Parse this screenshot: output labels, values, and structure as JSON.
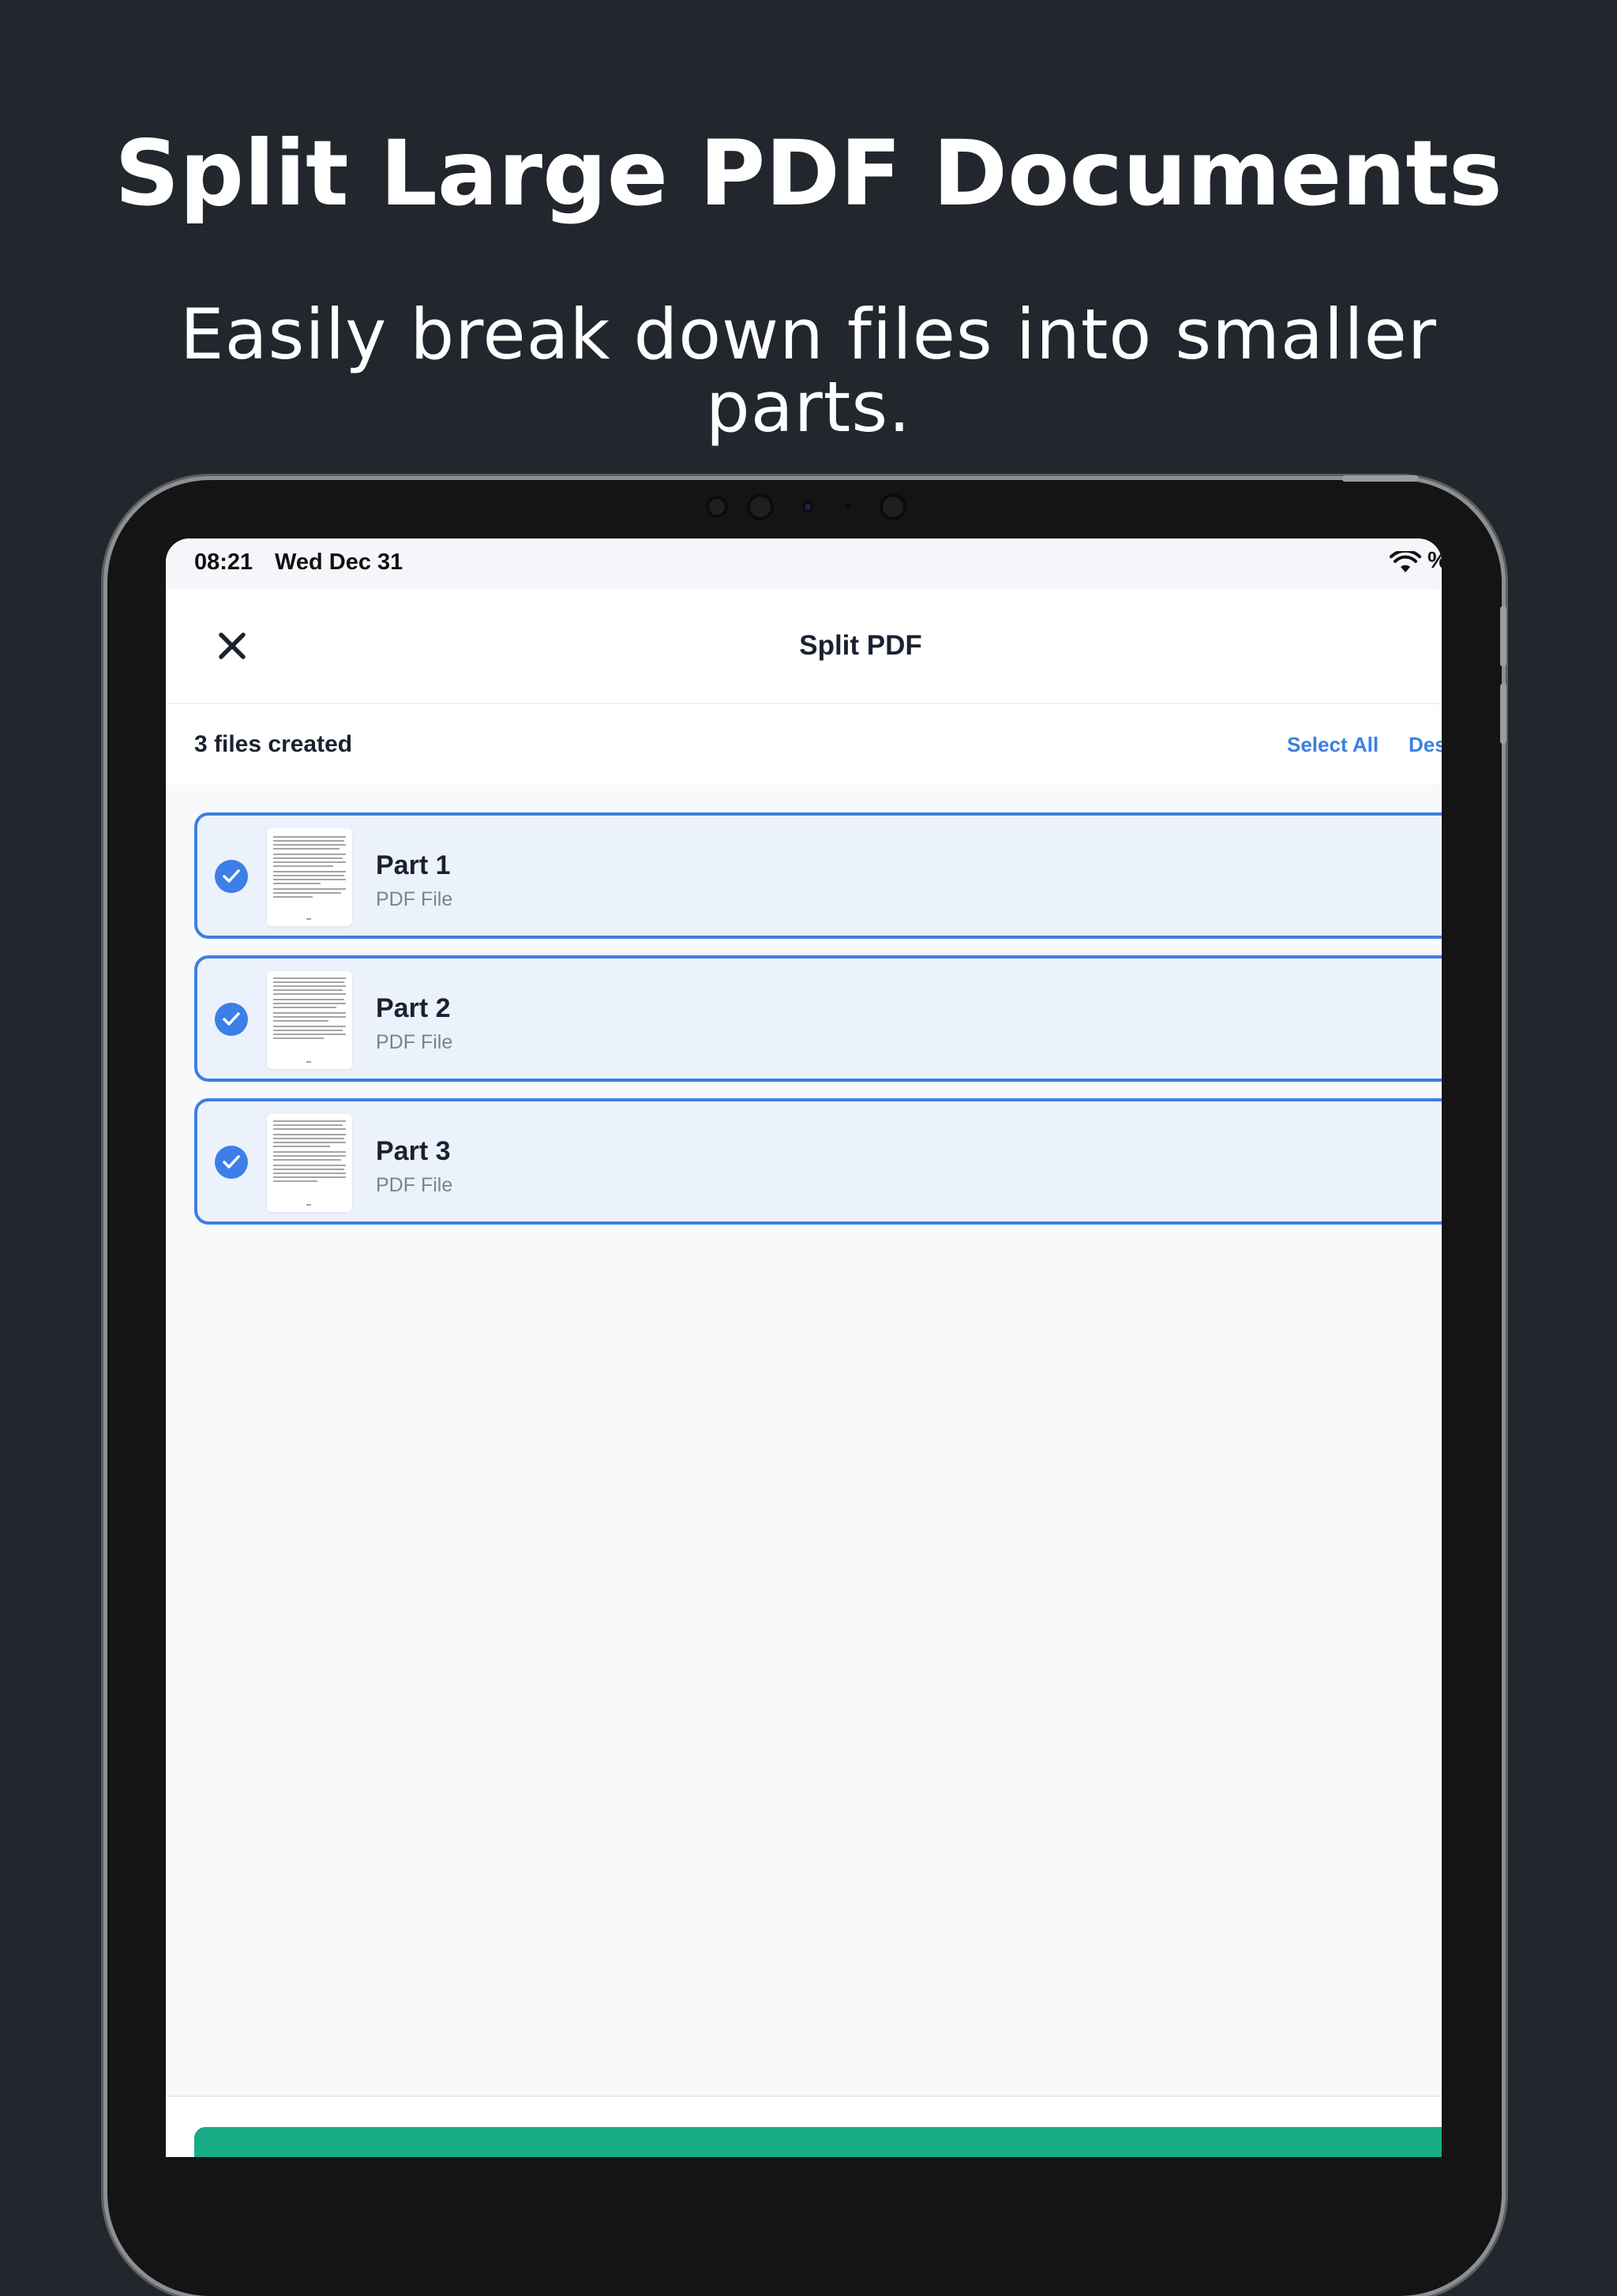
{
  "promo": {
    "headline": "Split Large PDF Documents",
    "subheadline": "Easily break down files into smaller parts."
  },
  "status_bar": {
    "time": "08:21",
    "date": "Wed Dec 31",
    "battery": "%"
  },
  "nav": {
    "title": "Split PDF",
    "close_icon": "close-icon"
  },
  "files_bar": {
    "count_label": "3 files created",
    "select_all_label": "Select All",
    "deselect_label": "Des"
  },
  "files": [
    {
      "name": "Part 1",
      "type": "PDF File",
      "selected": true
    },
    {
      "name": "Part 2",
      "type": "PDF File",
      "selected": true
    },
    {
      "name": "Part 3",
      "type": "PDF File",
      "selected": true
    }
  ],
  "colors": {
    "background": "#22262d",
    "accent": "#3d7fe0",
    "card_background": "#ecf2fc",
    "action_button": "#17ab86"
  }
}
